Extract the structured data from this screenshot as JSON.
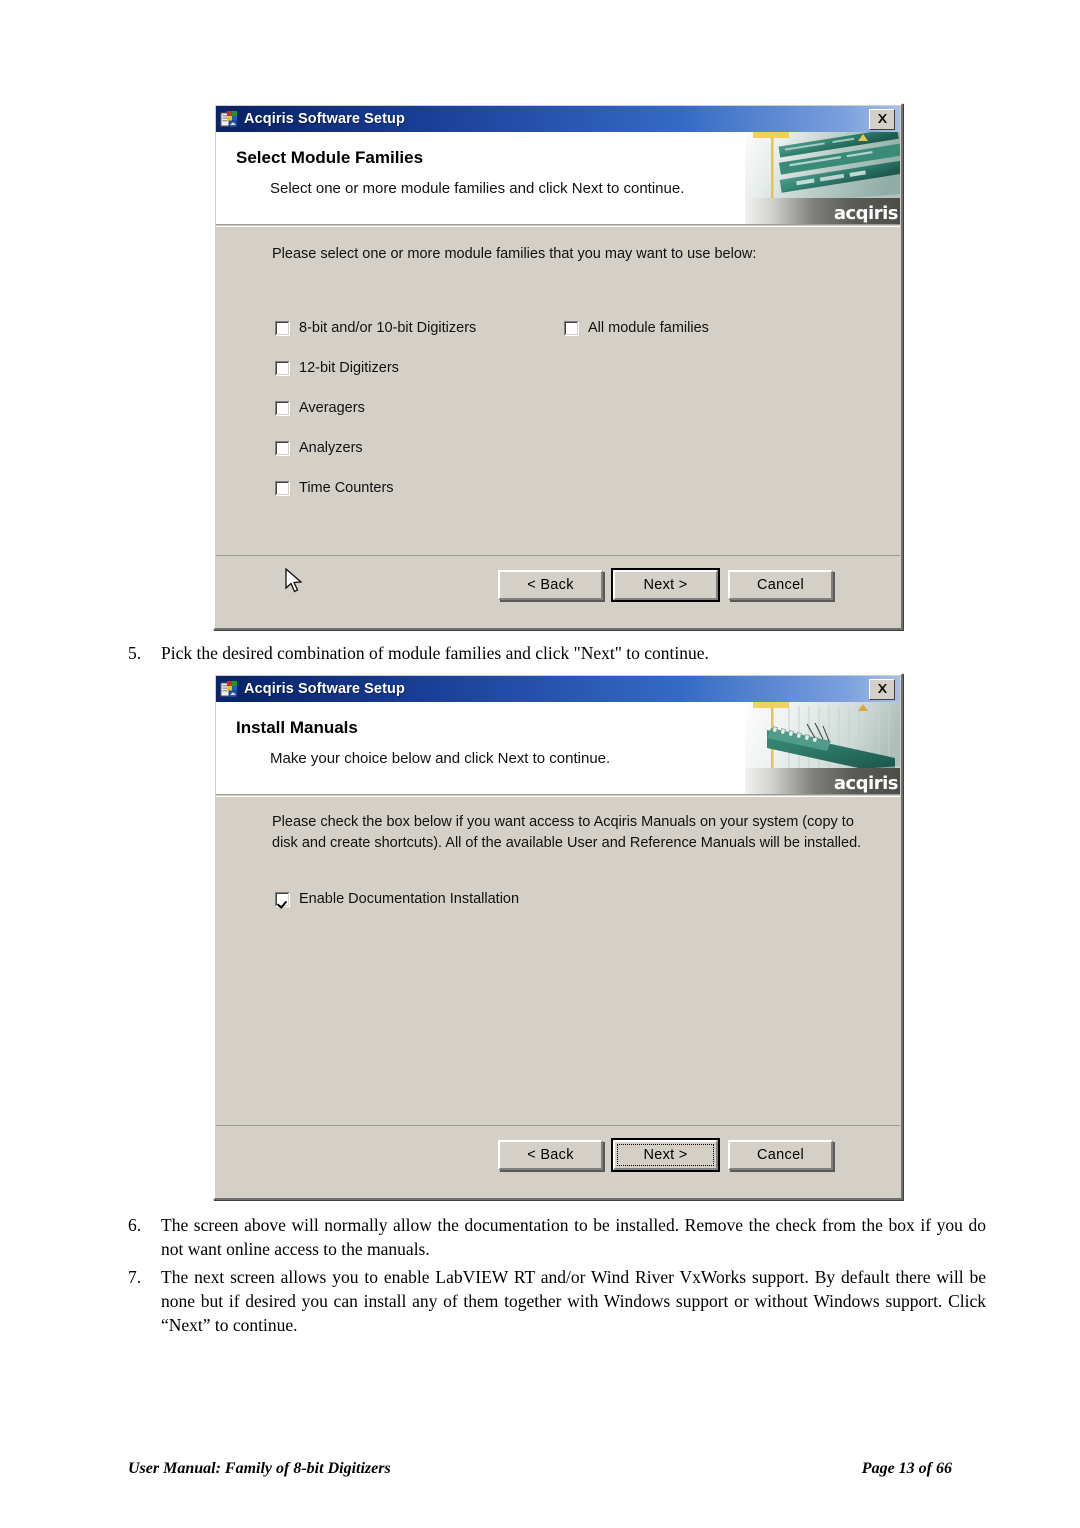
{
  "document": {
    "footer": {
      "left": "User Manual: Family of 8-bit Digitizers",
      "right": "Page 13 of 66"
    },
    "steps": [
      {
        "number": "5.",
        "text": "Pick the desired combination of module families and click \"Next\" to continue."
      },
      {
        "number": "6.",
        "text": "The screen above will normally allow the documentation to be installed. Remove the check from the box if you do not want online access to the manuals."
      },
      {
        "number": "7.",
        "text": "The next screen allows you to enable LabVIEW RT and/or Wind River VxWorks support. By default there will be none but if desired you can install any of them together with Windows support or without Windows support. Click “Next” to continue."
      }
    ]
  },
  "dialog1": {
    "titlebar": {
      "title": "Acqiris Software Setup",
      "icon": "installer-icon",
      "close_label": "close-icon"
    },
    "header": {
      "title": "Select Module Families",
      "subtitle": "Select one or more module families and click Next to continue.",
      "logo": "acqiris"
    },
    "body": {
      "instruction": "Please select one or more module families that you may want to use below:",
      "checkboxes_left": [
        {
          "label": "8-bit and/or 10-bit Digitizers",
          "checked": false
        },
        {
          "label": "12-bit Digitizers",
          "checked": false
        },
        {
          "label": "Averagers",
          "checked": false
        },
        {
          "label": "Analyzers",
          "checked": false
        },
        {
          "label": "Time Counters",
          "checked": false
        }
      ],
      "checkboxes_right": [
        {
          "label": "All module families",
          "checked": false
        }
      ]
    },
    "buttons": {
      "back": "< Back",
      "next": "Next >",
      "cancel": "Cancel"
    },
    "cursor": "arrow-pointer"
  },
  "dialog2": {
    "titlebar": {
      "title": "Acqiris Software Setup",
      "icon": "installer-icon",
      "close_label": "close-icon"
    },
    "header": {
      "title": "Install Manuals",
      "subtitle": "Make your choice below and click Next to continue.",
      "logo": "acqiris"
    },
    "body": {
      "instruction": "Please check the box below if you want access to Acqiris Manuals on your system (copy to disk and create shortcuts). All of the available User and Reference Manuals will be installed.",
      "checkboxes": [
        {
          "label": "Enable Documentation Installation",
          "checked": true
        }
      ]
    },
    "buttons": {
      "back": "< Back",
      "next": "Next >",
      "cancel": "Cancel"
    }
  },
  "colors": {
    "dialog_face": "#d4d0c8",
    "titlebar_start": "#0a246a",
    "titlebar_end": "#a6c0e8",
    "banner_teal": "#2f7f6e",
    "page_bg": "#ffffff",
    "text": "#000000"
  }
}
